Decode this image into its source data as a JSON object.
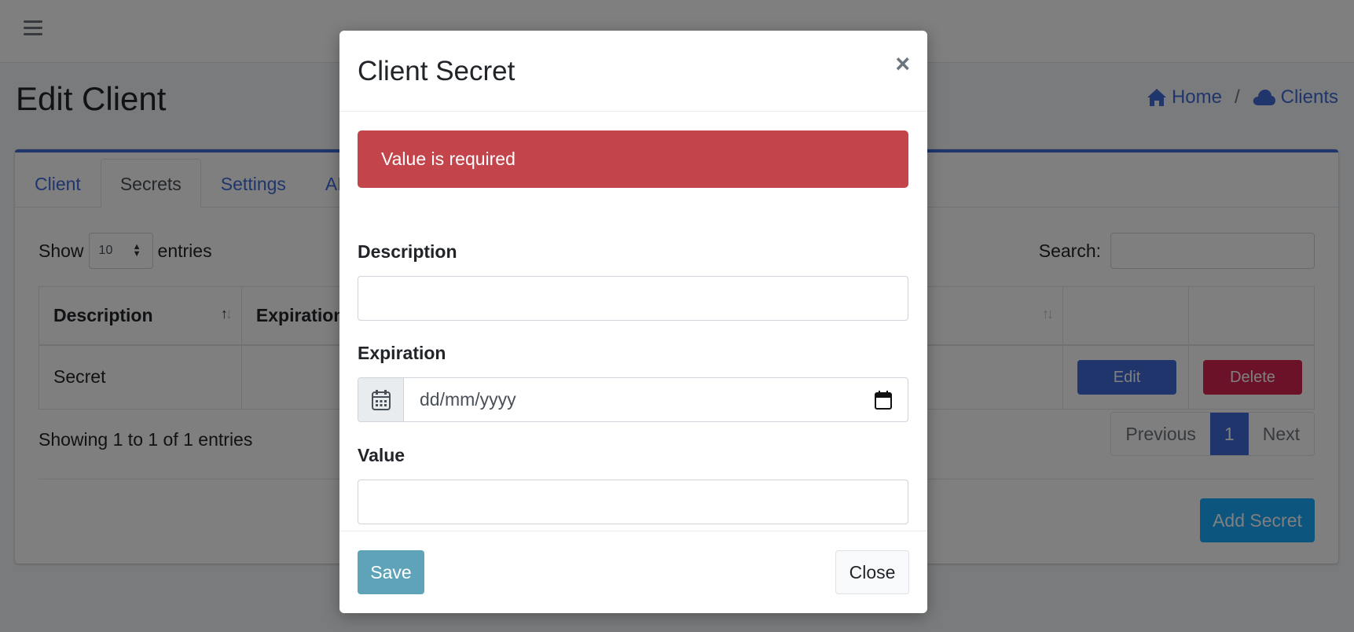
{
  "page": {
    "title": "Edit Client",
    "breadcrumb": [
      {
        "label": "Home",
        "icon": "home-icon"
      },
      {
        "label": "Clients",
        "icon": "cloud-icon"
      }
    ],
    "breadcrumb_sep": "/"
  },
  "tabs": [
    {
      "label": "Client",
      "active": false
    },
    {
      "label": "Secrets",
      "active": true
    },
    {
      "label": "Settings",
      "active": false
    },
    {
      "label": "AP",
      "active": false
    }
  ],
  "table_controls": {
    "show_label": "Show",
    "page_size": "10",
    "entries_label": "entries",
    "search_label": "Search:",
    "search_value": ""
  },
  "table": {
    "columns": [
      "Description",
      "Expiration",
      "",
      "",
      ""
    ],
    "rows": [
      {
        "description": "Secret",
        "expiration": "",
        "edit_label": "Edit",
        "delete_label": "Delete"
      }
    ],
    "showing": "Showing 1 to 1 of 1 entries"
  },
  "pagination": {
    "previous": "Previous",
    "current": "1",
    "next": "Next"
  },
  "add_secret_label": "Add Secret",
  "modal": {
    "title": "Client Secret",
    "close_symbol": "×",
    "alert": "Value is required",
    "description_label": "Description",
    "description_value": "",
    "expiration_label": "Expiration",
    "expiration_placeholder": "dd/mm/yyyy",
    "value_label": "Value",
    "value_value": "",
    "save_label": "Save",
    "close_label": "Close"
  },
  "colors": {
    "primary": "#3f6ad8",
    "danger": "#d92550",
    "alert": "#c3444b",
    "save": "#5fa3b8",
    "overlay": "rgba(0,0,0,0.5)"
  }
}
